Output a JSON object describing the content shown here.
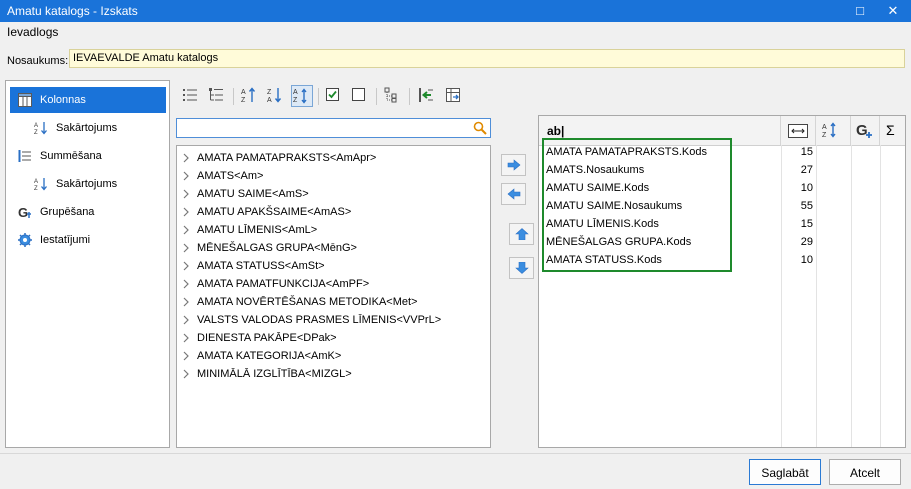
{
  "window": {
    "title": "Amatu katalogs - Izskats",
    "maximize_glyph": "□",
    "close_glyph": "✕"
  },
  "menu": {
    "item": "Ievadlogs"
  },
  "name_field": {
    "label": "Nosaukums:",
    "value": "IEVAEVALDE Amatu katalogs"
  },
  "left_nav": {
    "items": [
      {
        "label": "Kolonnas",
        "icon": "columns-icon",
        "active": true
      },
      {
        "label": "Sakārtojums",
        "icon": "sort-az-icon",
        "active": false
      },
      {
        "label": "Summēšana",
        "icon": "sum-list-icon",
        "active": false
      },
      {
        "label": "Sakārtojums",
        "icon": "sort-az-icon",
        "active": false
      },
      {
        "label": "Grupēšana",
        "icon": "group-icon",
        "active": false
      },
      {
        "label": "Iestatījumi",
        "icon": "gear-icon",
        "active": false
      }
    ]
  },
  "toolbar": {
    "buttons": [
      "list-view-icon",
      "tree-view-icon",
      "sort-ascending-icon",
      "sort-descending-icon",
      "sort-az-toggle-icon",
      "check-all-icon",
      "uncheck-all-icon",
      "hierarchy-icon",
      "import-icon",
      "export-icon"
    ]
  },
  "search": {
    "value": "",
    "icon": "search-icon"
  },
  "fields": [
    "AMATA PAMATAPRAKSTS<AmApr>",
    "AMATS<Am>",
    "AMATU SAIME<AmS>",
    "AMATU APAKŠSAIME<AmAS>",
    "AMATU LĪMENIS<AmL>",
    "MĒNEŠALGAS GRUPA<MēnG>",
    "AMATA STATUSS<AmSt>",
    "AMATA PAMATFUNKCIJA<AmPF>",
    "AMATA NOVĒRTĒŠANAS METODIKA<Met>",
    "VALSTS VALODAS PRASMES LĪMENIS<VVPrL>",
    "DIENESTA PAKĀPE<DPak>",
    "AMATA KATEGORIJA<AmK>",
    "MINIMĀLĀ IZGLĪTĪBA<MIZGL>"
  ],
  "grid": {
    "header_text": "ab|",
    "header_icons": [
      "column-width-icon",
      "sort-icon",
      "group-add-icon",
      "sigma-icon"
    ],
    "sigma_glyph": "Σ",
    "rows": [
      {
        "name": "AMATA PAMATAPRAKSTS.Kods",
        "width": "15"
      },
      {
        "name": "AMATS.Nosaukums",
        "width": "27"
      },
      {
        "name": "AMATU SAIME.Kods",
        "width": "10"
      },
      {
        "name": "AMATU SAIME.Nosaukums",
        "width": "55"
      },
      {
        "name": "AMATU LĪMENIS.Kods",
        "width": "15"
      },
      {
        "name": "MĒNEŠALGAS GRUPA.Kods",
        "width": "29"
      },
      {
        "name": "AMATA STATUSS.Kods",
        "width": "10"
      }
    ]
  },
  "buttons": {
    "save": "Saglabāt",
    "cancel": "Atcelt"
  },
  "colors": {
    "accent": "#1a73d9",
    "highlight_border": "#1e8a2c",
    "name_field_bg": "#fffbd9"
  }
}
